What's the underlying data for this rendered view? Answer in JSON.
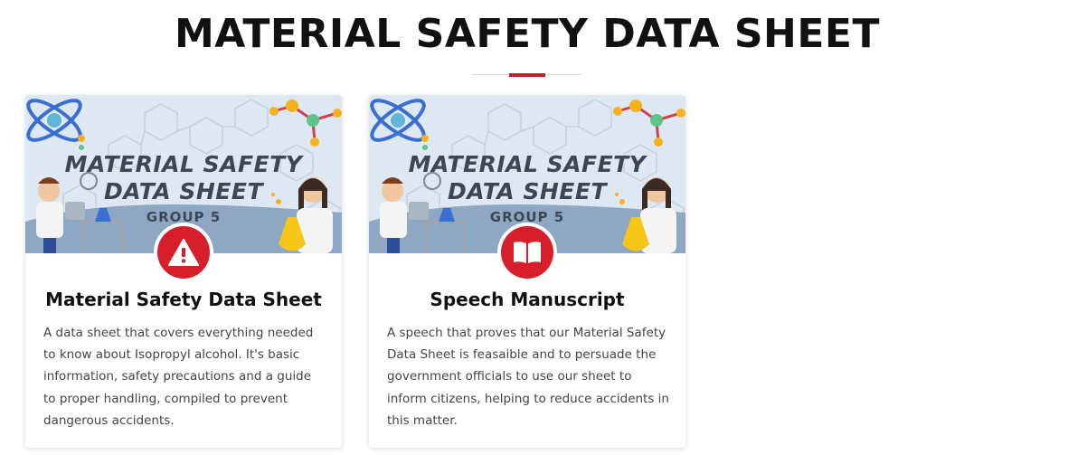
{
  "page": {
    "title": "MATERIAL SAFETY DATA SHEET",
    "accent_color": "#cc1a2a"
  },
  "cards": [
    {
      "banner": {
        "title_line1": "MATERIAL SAFETY",
        "title_line2": "DATA SHEET",
        "group": "GROUP 5"
      },
      "icon": "warning-icon",
      "heading": "Material Safety Data Sheet",
      "text": "A data sheet that covers everything needed to know about Isopropyl alcohol. It's basic information, safety precautions and a guide to proper handling, compiled to prevent dangerous accidents."
    },
    {
      "banner": {
        "title_line1": "MATERIAL SAFETY",
        "title_line2": "DATA SHEET",
        "group": "GROUP 5"
      },
      "icon": "book-open-icon",
      "heading": "Speech Manuscript",
      "text": "A speech that proves that our Material Safety Data Sheet is feasaible and to persuade the government officials to use our sheet to inform citizens, helping to reduce accidents in this matter."
    }
  ]
}
